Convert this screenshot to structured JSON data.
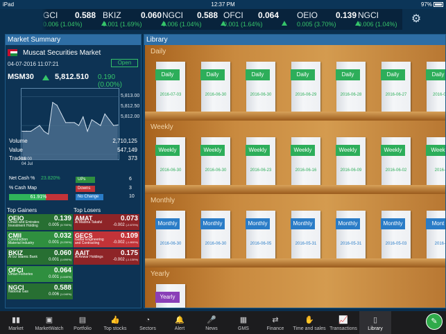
{
  "status": {
    "device": "iPad",
    "time": "12:37 PM",
    "battery": "97%"
  },
  "ticker": [
    {
      "sym": "GCI",
      "price": "0.588",
      "chg": "0.006 (1.04%)"
    },
    {
      "sym": "BKIZ",
      "price": "0.060",
      "chg": "0.001 (1.69%)"
    },
    {
      "sym": "NGCI",
      "price": "0.588",
      "chg": "0.006 (1.04%)"
    },
    {
      "sym": "OFCI",
      "price": "0.064",
      "chg": "0.001 (1.64%)"
    },
    {
      "sym": "OEIO",
      "price": "0.139",
      "chg": "0.005 (3.70%)"
    },
    {
      "sym": "NGCI",
      "price": "",
      "chg": "0.006 (1.04%)"
    }
  ],
  "market": {
    "title": "Market Summary",
    "name": "Muscat Securities Market",
    "datetime": "04-07-2016 11:07:21",
    "state": "Open",
    "index_name": "MSM30",
    "index_value": "5,812.510",
    "index_change": "0.190 (0.00%)",
    "y_ticks": [
      "5,813.00",
      "5,812.50",
      "5,812.00"
    ],
    "x_tick": [
      "10:00",
      "04 Jul"
    ],
    "volume_label": "Volume",
    "volume": "2,710,125",
    "value_label": "Value",
    "value": "547,149",
    "trades_label": "Trades",
    "trades": "373",
    "net_cash_label": "Net Cash %",
    "net_cash": "23.820%",
    "cash_map_label": "% Cash Map",
    "cash_map": "61.91%",
    "cash_map_frac": 0.6191,
    "ups_label": "UPs",
    "ups": "6",
    "downs_label": "Downs",
    "downs": "3",
    "nochange_label": "No Change",
    "nochange": "10",
    "gainers_title": "Top Gainers",
    "losers_title": "Top Losers",
    "gainers": [
      {
        "sym": "OEIO",
        "name": "Oman and Emirates Investment Holding",
        "price": "0.139",
        "chg": "0.005",
        "pct": "(3.700%)"
      },
      {
        "sym": "CMII",
        "name": "Construction Material Industry",
        "price": "0.032",
        "chg": "0.001",
        "pct": "(3.230%)"
      },
      {
        "sym": "BKIZ",
        "name": "Al Izz Islamic Bank",
        "price": "0.060",
        "chg": "0.001",
        "pct": "(1.690%)"
      },
      {
        "sym": "OFCI",
        "name": "Oman Fisheries",
        "price": "0.064",
        "chg": "0.001",
        "pct": "(1.640%)"
      },
      {
        "sym": "NGCI",
        "name": "National Gas",
        "price": "0.588",
        "chg": "0.006",
        "pct": "(1.040%)"
      }
    ],
    "losers": [
      {
        "sym": "AMAT",
        "name": "Al Madina Takaful",
        "price": "0.073",
        "chg": "-0.002",
        "pct": "(-2.670%)"
      },
      {
        "sym": "GECS",
        "name": "Galfar Engineering and Contracting",
        "price": "0.109",
        "chg": "-0.002",
        "pct": "(-1.800%)"
      },
      {
        "sym": "AAIT",
        "name": "Al Anwar Holdings",
        "price": "0.175",
        "chg": "-0.002",
        "pct": "(-1.130%)"
      }
    ]
  },
  "chart_data": {
    "type": "line",
    "x": [
      "10:00"
    ],
    "values": [
      5812.4,
      5812.4,
      5812.4,
      5812.45,
      5812.5,
      5812.4,
      5812.35,
      5812.9,
      5812.85,
      5812.7,
      5812.55,
      5812.55,
      5812.55,
      5812.5,
      5812.65,
      5812.4,
      5812.6,
      5812.55,
      5812.5,
      5812.7,
      5812.6,
      5812.5,
      5812.51
    ],
    "ylim": [
      5811.9,
      5813.15
    ],
    "xlabel": "",
    "ylabel": ""
  },
  "library": {
    "title": "Library",
    "shelves": [
      {
        "name": "Daily",
        "color": "#2dae5a",
        "books": [
          {
            "label": "Daily",
            "date": "2016-07-03"
          },
          {
            "label": "Daily",
            "date": "2016-06-30"
          },
          {
            "label": "Daily",
            "date": "2016-06-30"
          },
          {
            "label": "Daily",
            "date": "2016-06-29"
          },
          {
            "label": "Daily",
            "date": "2016-06-28"
          },
          {
            "label": "Daily",
            "date": "2016-06-27"
          },
          {
            "label": "Daily",
            "date": "2016-06-"
          }
        ]
      },
      {
        "name": "Weekly",
        "color": "#2dae5a",
        "books": [
          {
            "label": "Weekly",
            "date": "2016-06-30"
          },
          {
            "label": "Weekly",
            "date": "2016-06-30"
          },
          {
            "label": "Weekly",
            "date": "2016-06-23"
          },
          {
            "label": "Weekly",
            "date": "2016-06-16"
          },
          {
            "label": "Weekly",
            "date": "2016-06-09"
          },
          {
            "label": "Weekly",
            "date": "2016-06-02"
          },
          {
            "label": "Week",
            "date": "2016-0"
          }
        ]
      },
      {
        "name": "Monthly",
        "color": "#2a7cc7",
        "books": [
          {
            "label": "Monthly",
            "date": "2016-06-30"
          },
          {
            "label": "Monthly",
            "date": "2016-06-30"
          },
          {
            "label": "Monthly",
            "date": "2016-06-05"
          },
          {
            "label": "Monthly",
            "date": "2016-05-31"
          },
          {
            "label": "Monthly",
            "date": "2016-05-31"
          },
          {
            "label": "Monthly",
            "date": "2016-05-03"
          },
          {
            "label": "Mont",
            "date": "2016-0"
          }
        ]
      },
      {
        "name": "Yearly",
        "color": "#8a3fb8",
        "books": [
          {
            "label": "Yearly",
            "date": ""
          }
        ]
      }
    ]
  },
  "tabs": [
    {
      "label": "Market",
      "icon": "bar-chart-icon"
    },
    {
      "label": "MarketWatch",
      "icon": "briefcase-icon"
    },
    {
      "label": "Portfolio",
      "icon": "portfolio-icon"
    },
    {
      "label": "Top stocks",
      "icon": "thumbs-up-icon"
    },
    {
      "label": "Sectors",
      "icon": "pie-chart-icon"
    },
    {
      "label": "Alert",
      "icon": "bell-icon"
    },
    {
      "label": "News",
      "icon": "microphone-icon"
    },
    {
      "label": "GMS",
      "icon": "grid-icon"
    },
    {
      "label": "Finance",
      "icon": "shuffle-icon"
    },
    {
      "label": "Time and sales",
      "icon": "handshake-icon"
    },
    {
      "label": "Transactions",
      "icon": "line-chart-icon"
    },
    {
      "label": "Library",
      "icon": "book-icon"
    }
  ],
  "colors": {
    "up": "#35c46a",
    "down": "#c23338",
    "header": "#2e6ea5"
  }
}
